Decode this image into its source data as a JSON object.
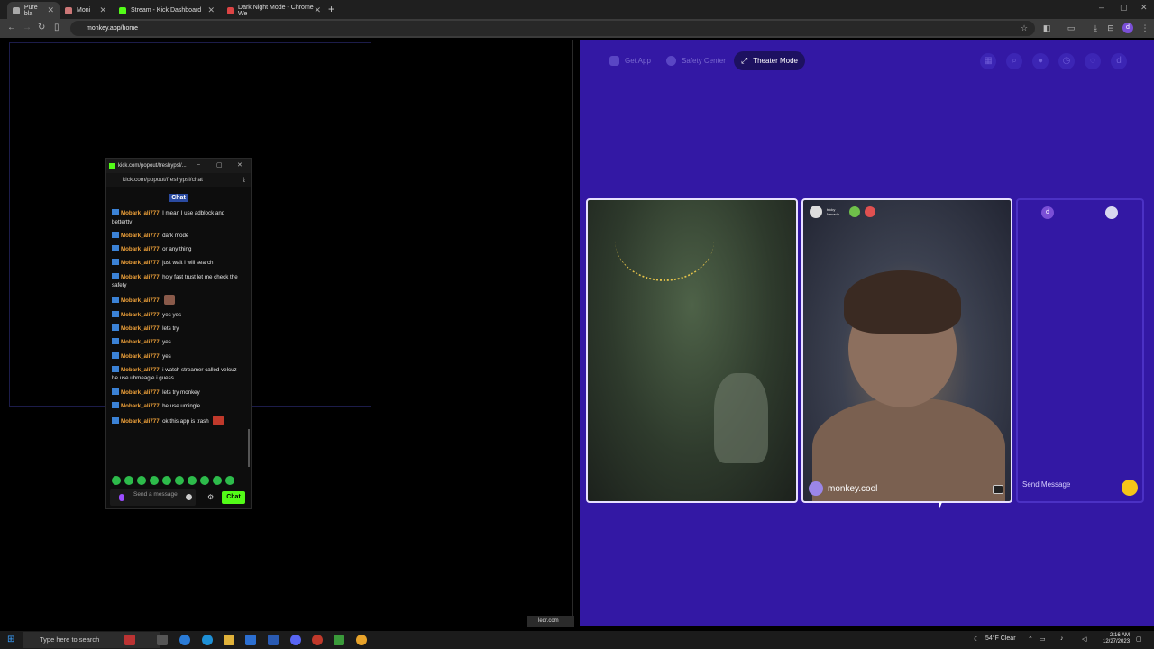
{
  "browser": {
    "tabs": [
      {
        "label": "Pure bla",
        "active": true
      },
      {
        "label": "Moni",
        "active": false
      },
      {
        "label": "Stream - Kick Dashboard",
        "active": false
      },
      {
        "label": "Dark Night Mode - Chrome We",
        "active": false
      }
    ],
    "url": "monkey.app/home"
  },
  "popout": {
    "title": "kick.com/popout/freshypsl/...",
    "url": "kick.com/popout/freshypsl/chat",
    "chat_tab": "Chat",
    "messages": [
      {
        "user": "Mobark_ali777",
        "text": ": I mean I use adblock and betterttv"
      },
      {
        "user": "Mobark_ali777",
        "text": ": dark mode"
      },
      {
        "user": "Mobark_ali777",
        "text": ": or any thing"
      },
      {
        "user": "Mobark_ali777",
        "text": ": just wait I will search"
      },
      {
        "user": "Mobark_ali777",
        "text": ": holy fast trust let me check the safety"
      },
      {
        "user": "Mobark_ali777",
        "text": ":",
        "emote": true
      },
      {
        "user": "Mobark_ali777",
        "text": ": yes yes"
      },
      {
        "user": "Mobark_ali777",
        "text": ": lets try"
      },
      {
        "user": "Mobark_ali777",
        "text": ": yes"
      },
      {
        "user": "Mobark_ali777",
        "text": ": yes"
      },
      {
        "user": "Mobark_ali777",
        "text": ": i watch streamer called velcuz he use uhmeagle i guess"
      },
      {
        "user": "Mobark_ali777",
        "text": ": lets try monkey"
      },
      {
        "user": "Mobark_ali777",
        "text": ": he use umingle"
      },
      {
        "user": "Mobark_ali777",
        "text": ": ok this app is trash",
        "emote_red": true
      }
    ],
    "input_placeholder": "Send a message",
    "chat_button": "Chat"
  },
  "monkey": {
    "get_app": "Get App",
    "safety_center": "Safety Center",
    "theater_mode": "Theater Mode",
    "avatar_letter": "d",
    "peer_name": "monkey.cool",
    "peer_location": "tricky Nevada",
    "send_message": "Send Message",
    "tile3_avatar": "d"
  },
  "taskbar": {
    "search_placeholder": "Type here to search",
    "weather": "54°F  Clear",
    "time": "2:16 AM",
    "date": "12/27/2023",
    "ledr_label": "ledr.com"
  }
}
